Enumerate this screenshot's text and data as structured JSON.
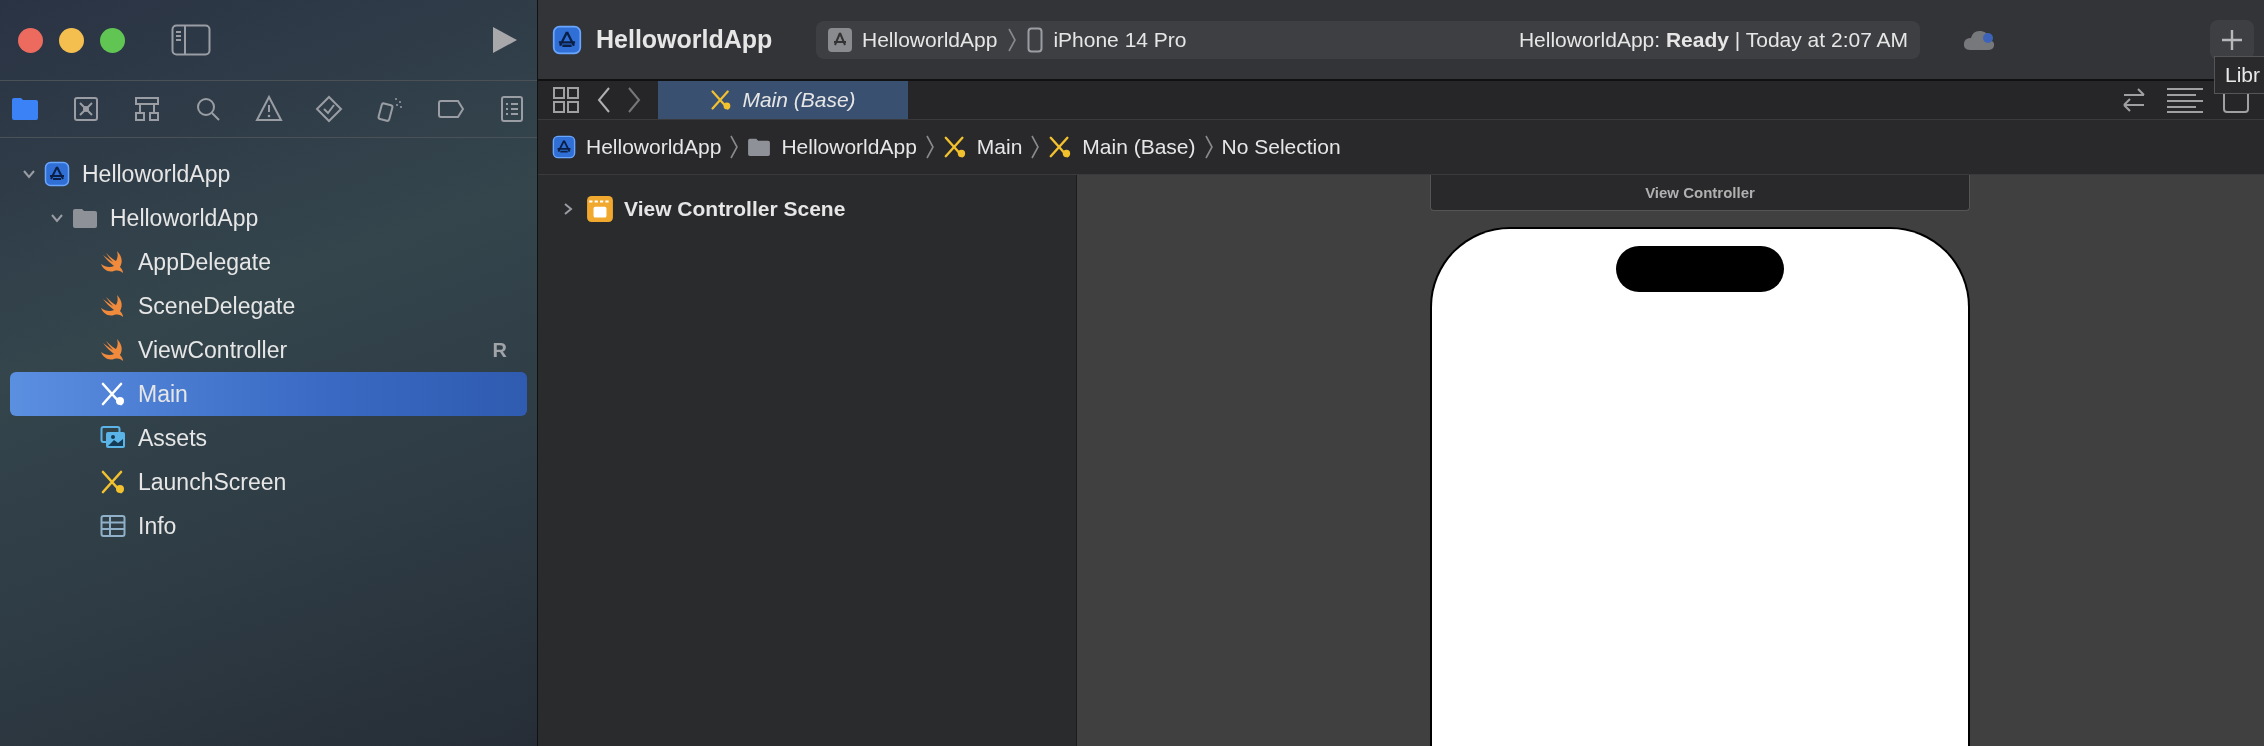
{
  "window": {
    "traffic_lights": [
      {
        "color": "#ec6a5e"
      },
      {
        "color": "#f4bf4f"
      },
      {
        "color": "#61c554"
      }
    ]
  },
  "toolbar": {
    "project_title": "HelloworldApp",
    "scheme": {
      "target": "HelloworldApp",
      "device": "iPhone 14 Pro"
    },
    "status": "HelloworldApp: **Ready** | Today at 2:07 AM",
    "tooltip": "Libr"
  },
  "navigator_tabs": [
    {
      "kind": "folder",
      "selected": true
    },
    {
      "kind": "source-control",
      "selected": false
    },
    {
      "kind": "hierarchy",
      "selected": false
    },
    {
      "kind": "search",
      "selected": false
    },
    {
      "kind": "warning",
      "selected": false
    },
    {
      "kind": "test",
      "selected": false
    },
    {
      "kind": "debug",
      "selected": false
    },
    {
      "kind": "breakpoint",
      "selected": false
    },
    {
      "kind": "report",
      "selected": false
    }
  ],
  "navigator_tree": [
    {
      "kind": "project",
      "label": "HelloworldApp",
      "expanded": true,
      "selected": false,
      "children": [
        {
          "kind": "folder",
          "label": "HelloworldApp",
          "expanded": true,
          "selected": false,
          "children": [
            {
              "kind": "swift",
              "label": "AppDelegate",
              "selected": false
            },
            {
              "kind": "swift",
              "label": "SceneDelegate",
              "selected": false
            },
            {
              "kind": "swift",
              "label": "ViewController",
              "badge": "R",
              "selected": false
            },
            {
              "kind": "storyboard",
              "label": "Main",
              "selected": true
            },
            {
              "kind": "assets",
              "label": "Assets",
              "selected": false
            },
            {
              "kind": "storyboard",
              "label": "LaunchScreen",
              "selected": false
            },
            {
              "kind": "plist",
              "label": "Info",
              "selected": false
            }
          ]
        }
      ]
    }
  ],
  "editor_tabs": [
    {
      "label": "Main (Base)",
      "selected": true
    }
  ],
  "breadcrumb": [
    {
      "kind": "project",
      "label": "HelloworldApp"
    },
    {
      "kind": "folder",
      "label": "HelloworldApp"
    },
    {
      "kind": "storyboard",
      "label": "Main"
    },
    {
      "kind": "storyboard",
      "label": "Main (Base)"
    },
    {
      "kind": "plain",
      "label": "No Selection"
    }
  ],
  "outline": [
    {
      "kind": "scene",
      "label": "View Controller Scene",
      "expanded": false
    }
  ],
  "canvas": {
    "scene_title": "View Controller"
  }
}
